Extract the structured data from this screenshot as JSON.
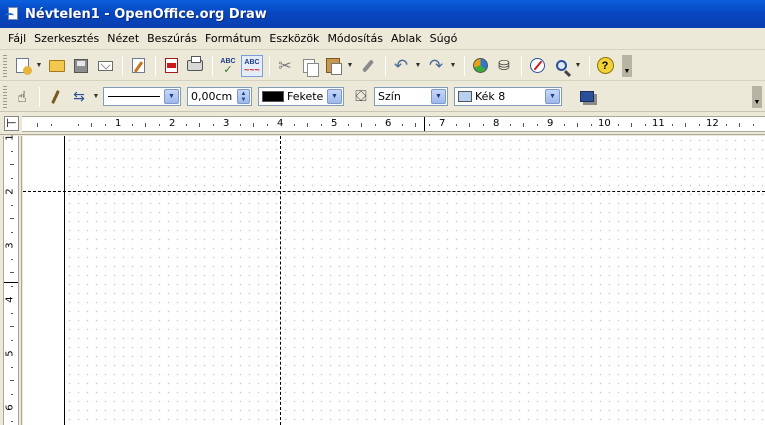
{
  "window": {
    "title": "Névtelen1 - OpenOffice.org Draw"
  },
  "menu": {
    "items": [
      "Fájl",
      "Szerkesztés",
      "Nézet",
      "Beszúrás",
      "Formátum",
      "Eszközök",
      "Módosítás",
      "Ablak",
      "Súgó"
    ]
  },
  "toolbar_standard": {
    "icons": [
      "new-icon",
      "open-icon",
      "save-icon",
      "mail-icon",
      "edit-file-icon",
      "export-pdf-icon",
      "print-icon",
      "spellcheck-icon",
      "autospell-icon",
      "cut-icon",
      "copy-icon",
      "paste-icon",
      "format-paintbrush-icon",
      "undo-icon",
      "redo-icon",
      "chart-icon",
      "datasource-icon",
      "navigator-icon",
      "zoom-icon",
      "help-icon"
    ],
    "spell_label": "ABC",
    "autospell_label": "ABC",
    "help_label": "?"
  },
  "toolbar_lines_filling": {
    "line_style": "",
    "line_width": "0,00cm",
    "line_color": {
      "label": "Fekete",
      "swatch": "#000000"
    },
    "area_style": "Szín",
    "area_color": {
      "label": "Kék 8",
      "swatch": "#b8d0f0"
    }
  },
  "ruler_h": {
    "labels": [
      "1",
      "2",
      "3",
      "4",
      "5",
      "6",
      "7",
      "8",
      "9",
      "10",
      "11",
      "12"
    ]
  },
  "ruler_v": {
    "labels": [
      "1",
      "2",
      "3",
      "4",
      "5",
      "6"
    ]
  },
  "colors": {
    "titlebar": "#0a5fdc",
    "chrome": "#ece9d8",
    "combo_border": "#7f9db9"
  }
}
